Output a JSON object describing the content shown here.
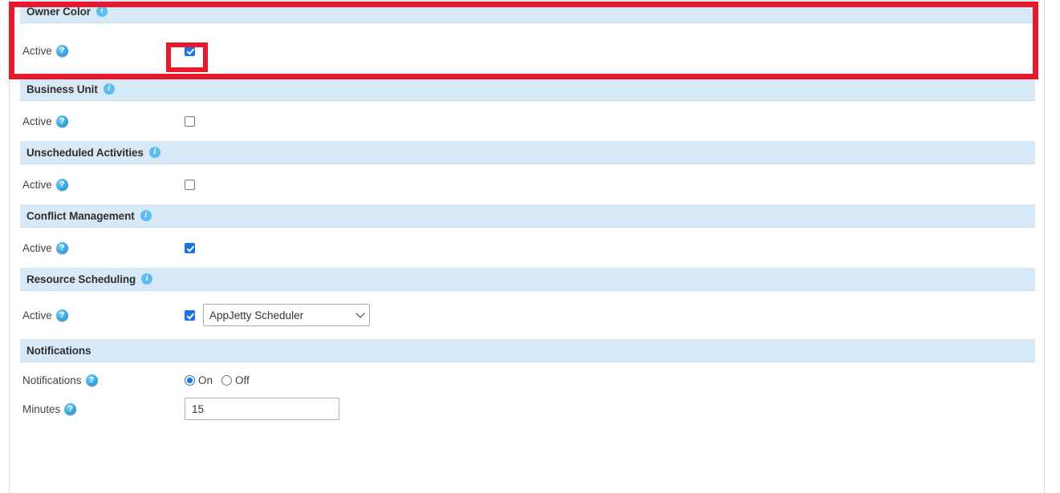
{
  "colors": {
    "section_header_bg": "#d7e9f7",
    "section_header_border": "#c3dcef",
    "highlight_red": "#e8192c",
    "checkbox_blue": "#1a73e8",
    "info_icon_blue": "#5cbdf0",
    "help_icon_blue": "#3ba7e0",
    "text": "#444444",
    "rule": "#dfdfdf"
  },
  "icons": {
    "info": "info-icon",
    "help": "help-icon",
    "chevron_down": "chevron-down-icon",
    "checkmark": "checkmark-icon"
  },
  "sections": [
    {
      "id": "owner-color",
      "title": "Owner Color",
      "has_info_icon": true,
      "highlighted": true,
      "rows": [
        {
          "type": "checkbox",
          "label": "Active",
          "has_help_icon": true,
          "checked": true,
          "highlighted": true
        }
      ]
    },
    {
      "id": "business-unit",
      "title": "Business Unit",
      "has_info_icon": true,
      "highlighted": false,
      "rows": [
        {
          "type": "checkbox",
          "label": "Active",
          "has_help_icon": true,
          "checked": false,
          "highlighted": false
        }
      ]
    },
    {
      "id": "unscheduled-activities",
      "title": "Unscheduled Activities",
      "has_info_icon": true,
      "highlighted": false,
      "rows": [
        {
          "type": "checkbox",
          "label": "Active",
          "has_help_icon": true,
          "checked": false,
          "highlighted": false
        }
      ]
    },
    {
      "id": "conflict-management",
      "title": "Conflict Management",
      "has_info_icon": true,
      "highlighted": false,
      "rows": [
        {
          "type": "checkbox",
          "label": "Active",
          "has_help_icon": true,
          "checked": true,
          "highlighted": false
        }
      ]
    },
    {
      "id": "resource-scheduling",
      "title": "Resource Scheduling",
      "has_info_icon": true,
      "highlighted": false,
      "rows": [
        {
          "type": "checkbox-select",
          "label": "Active",
          "has_help_icon": true,
          "checked": true,
          "select": {
            "name": "scheduler-select",
            "value": "AppJetty Scheduler",
            "options": [
              "AppJetty Scheduler"
            ]
          }
        }
      ]
    },
    {
      "id": "notifications",
      "title": "Notifications",
      "has_info_icon": false,
      "highlighted": false,
      "rows": [
        {
          "type": "radio",
          "label": "Notifications",
          "has_help_icon": true,
          "options": [
            {
              "label": "On",
              "selected": true
            },
            {
              "label": "Off",
              "selected": false
            }
          ]
        },
        {
          "type": "text",
          "label": "Minutes",
          "has_help_icon": true,
          "value": "15",
          "placeholder": ""
        }
      ]
    }
  ]
}
